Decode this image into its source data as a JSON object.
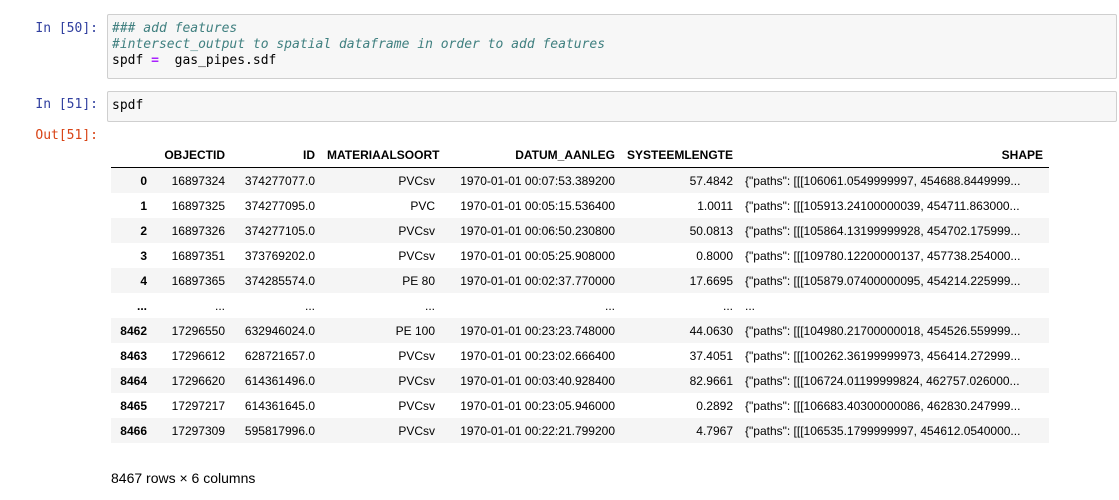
{
  "cells": [
    {
      "prompt": "In [50]:",
      "lines": [
        {
          "parts": [
            {
              "t": "### add features",
              "k": "comment"
            }
          ]
        },
        {
          "parts": [
            {
              "t": "#intersect_output to spatial dataframe in order to add features",
              "k": "comment"
            }
          ]
        },
        {
          "parts": [
            {
              "t": "spdf ",
              "k": ""
            },
            {
              "t": "=",
              "k": "op"
            },
            {
              "t": "  gas_pipes.sdf",
              "k": ""
            }
          ]
        }
      ]
    },
    {
      "prompt": "In [51]:",
      "lines": [
        {
          "parts": [
            {
              "t": "spdf",
              "k": ""
            }
          ]
        }
      ]
    }
  ],
  "output": {
    "prompt": "Out[51]:",
    "columns": [
      "",
      "OBJECTID",
      "ID",
      "MATERIAALSOORT",
      "DATUM_AANLEG",
      "SYSTEEMLENGTE",
      "SHAPE"
    ],
    "rows": [
      [
        "0",
        "16897324",
        "374277077.0",
        "PVCsv",
        "1970-01-01 00:07:53.389200",
        "57.4842",
        "{\"paths\": [[[106061.0549999997, 454688.8449999..."
      ],
      [
        "1",
        "16897325",
        "374277095.0",
        "PVC",
        "1970-01-01 00:05:15.536400",
        "1.0011",
        "{\"paths\": [[[105913.24100000039, 454711.863000..."
      ],
      [
        "2",
        "16897326",
        "374277105.0",
        "PVCsv",
        "1970-01-01 00:06:50.230800",
        "50.0813",
        "{\"paths\": [[[105864.13199999928, 454702.175999..."
      ],
      [
        "3",
        "16897351",
        "373769202.0",
        "PVCsv",
        "1970-01-01 00:05:25.908000",
        "0.8000",
        "{\"paths\": [[[109780.12200000137, 457738.254000..."
      ],
      [
        "4",
        "16897365",
        "374285574.0",
        "PE 80",
        "1970-01-01 00:02:37.770000",
        "17.6695",
        "{\"paths\": [[[105879.07400000095, 454214.225999..."
      ],
      [
        "...",
        "...",
        "...",
        "...",
        "...",
        "...",
        "..."
      ],
      [
        "8462",
        "17296550",
        "632946024.0",
        "PE 100",
        "1970-01-01 00:23:23.748000",
        "44.0630",
        "{\"paths\": [[[104980.21700000018, 454526.559999..."
      ],
      [
        "8463",
        "17296612",
        "628721657.0",
        "PVCsv",
        "1970-01-01 00:23:02.666400",
        "37.4051",
        "{\"paths\": [[[100262.36199999973, 456414.272999..."
      ],
      [
        "8464",
        "17296620",
        "614361496.0",
        "PVCsv",
        "1970-01-01 00:03:40.928400",
        "82.9661",
        "{\"paths\": [[[106724.01199999824, 462757.026000..."
      ],
      [
        "8465",
        "17297217",
        "614361645.0",
        "PVCsv",
        "1970-01-01 00:23:05.946000",
        "0.2892",
        "{\"paths\": [[[106683.40300000086, 462830.247999..."
      ],
      [
        "8466",
        "17297309",
        "595817996.0",
        "PVCsv",
        "1970-01-01 00:22:21.799200",
        "4.7967",
        "{\"paths\": [[[106535.1799999997, 454612.0540000..."
      ]
    ],
    "summary": "8467 rows × 6 columns"
  }
}
